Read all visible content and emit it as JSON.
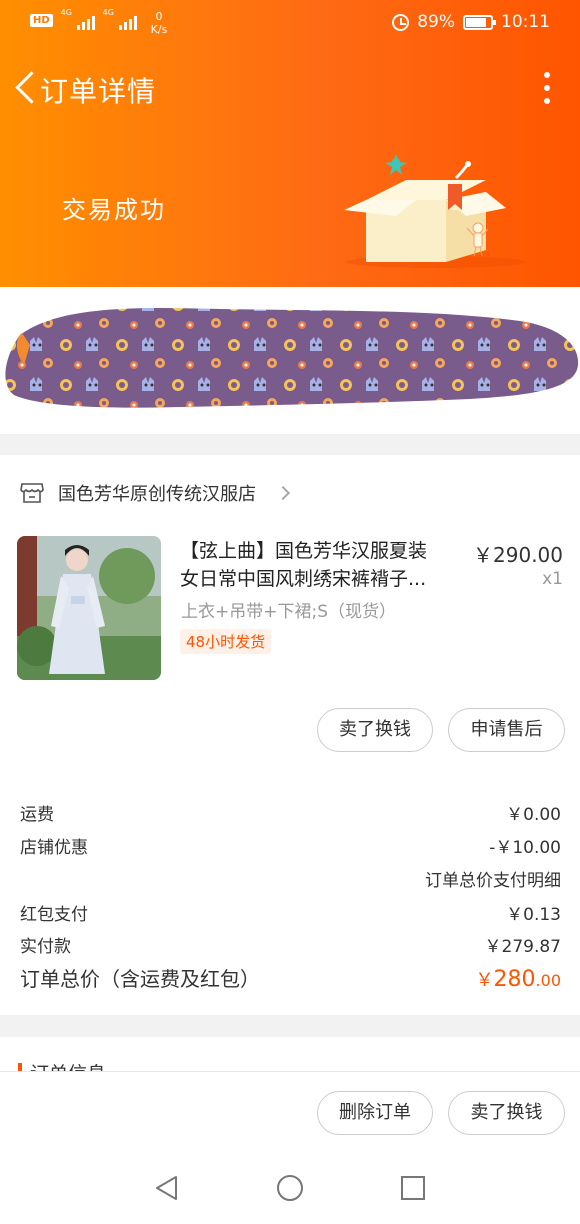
{
  "status_bar": {
    "hd": "HD",
    "sim1": "4G",
    "sim2": "4G",
    "speed_value": "0",
    "speed_unit": "K/s",
    "battery": "89%",
    "time": "10:11"
  },
  "nav": {
    "title": "订单详情"
  },
  "order_status": "交易成功",
  "shop": {
    "name": "国色芳华原创传统汉服店"
  },
  "product": {
    "title_line1": "【弦上曲】国色芳华汉服夏装",
    "title_line2": "女日常中国风刺绣宋裤褙子...",
    "price": "￥290.00",
    "quantity": "x1",
    "sku": "上衣+吊带+下裙;S（现货）",
    "tag": "48小时发货"
  },
  "item_actions": {
    "resell": "卖了换钱",
    "after_sale": "申请售后"
  },
  "fees": {
    "freight_label": "运费",
    "freight_value": "￥0.00",
    "discount_label": "店铺优惠",
    "discount_value": "-￥10.00",
    "detail_link": "订单总价支付明细",
    "redpacket_label": "红包支付",
    "redpacket_value": "￥0.13",
    "paid_label": "实付款",
    "paid_value": "￥279.87",
    "total_label": "订单总价（含运费及红包）",
    "total_currency": "￥",
    "total_int": "280",
    "total_dec": ".00"
  },
  "order_info": {
    "title": "订单信息"
  },
  "bottom_actions": {
    "delete": "删除订单",
    "resell": "卖了换钱"
  },
  "colors": {
    "accent": "#ff5500",
    "header_start": "#ff8f00",
    "header_end": "#ff5500",
    "redact": "#7a5c8c"
  },
  "icons": {
    "back": "chevron-left-icon",
    "more": "more-vertical-icon",
    "shop": "store-icon",
    "shop_arrow": "chevron-right-icon",
    "sys_back": "triangle-back-icon",
    "sys_home": "circle-home-icon",
    "sys_recent": "square-recent-icon"
  }
}
